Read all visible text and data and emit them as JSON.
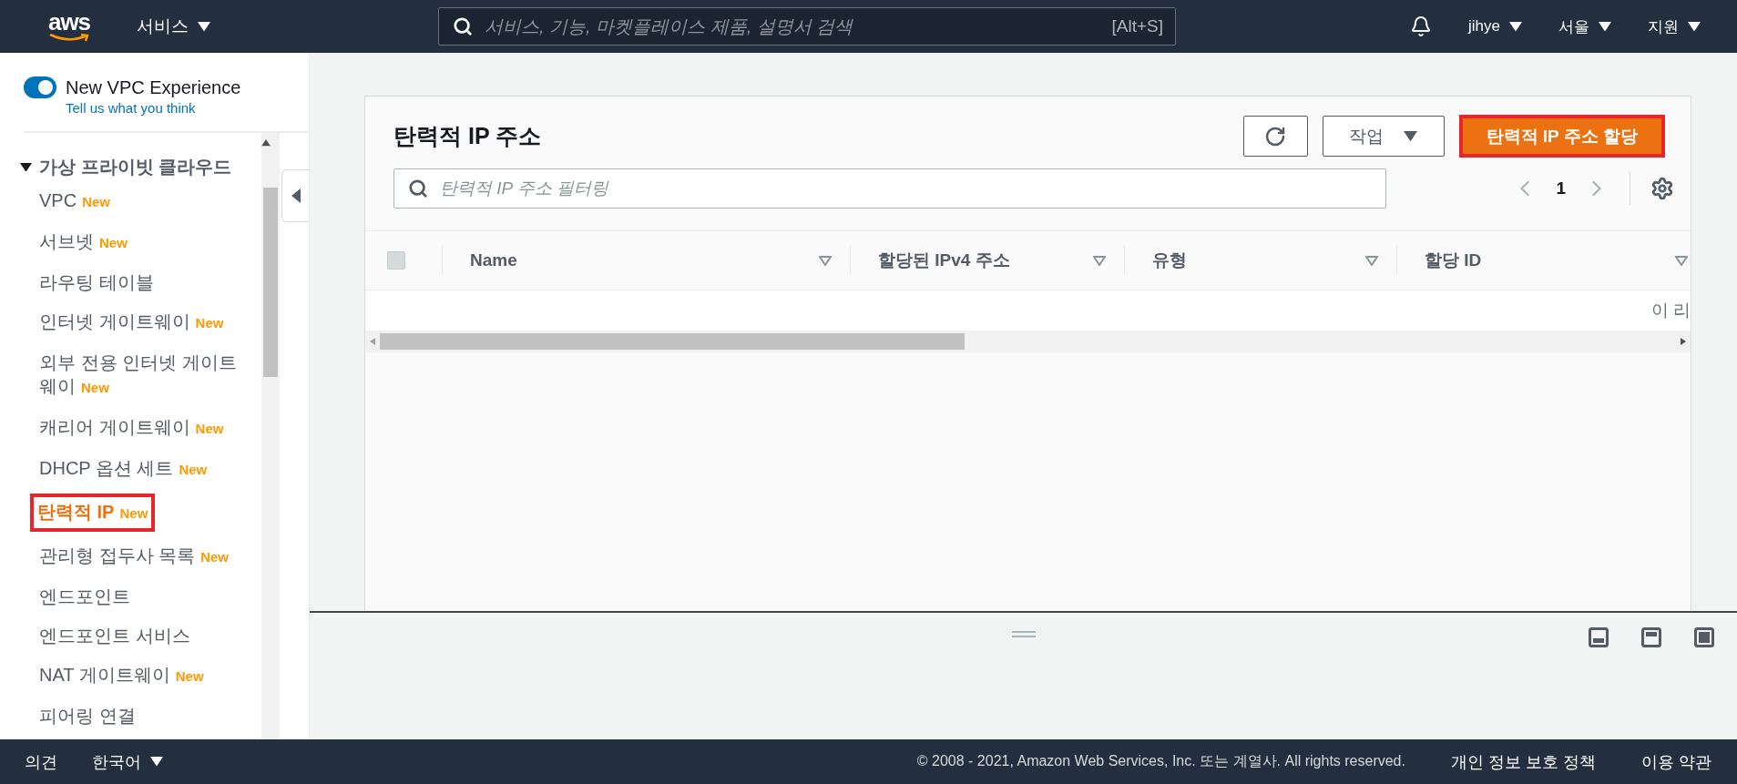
{
  "top_bar": {
    "logo": "aws",
    "services_menu": "서비스",
    "search": {
      "placeholder": "서비스, 기능, 마켓플레이스 제품, 설명서 검색",
      "shortcut": "[Alt+S]"
    },
    "user_menu": "jihye",
    "region_menu": "서울",
    "support_menu": "지원"
  },
  "sidebar": {
    "toggle": {
      "label": "New VPC Experience",
      "on": true
    },
    "feedback_link": "Tell us what you think",
    "section": {
      "title": "가상 프라이빗 클라우드",
      "expanded": true,
      "items": [
        {
          "label": "VPC",
          "badge": "New",
          "selected": false,
          "highlighted": false
        },
        {
          "label": "서브넷",
          "badge": "New",
          "selected": false,
          "highlighted": false
        },
        {
          "label": "라우팅 테이블",
          "selected": false,
          "highlighted": false
        },
        {
          "label": "인터넷 게이트웨이",
          "badge": "New",
          "selected": false,
          "highlighted": false
        },
        {
          "label": "외부 전용 인터넷 게이트웨이",
          "badge": "New",
          "selected": false,
          "highlighted": false
        },
        {
          "label": "캐리어 게이트웨이",
          "badge": "New",
          "selected": false,
          "highlighted": false
        },
        {
          "label": "DHCP 옵션 세트",
          "badge": "New",
          "selected": false,
          "highlighted": false
        },
        {
          "label": "탄력적 IP",
          "badge": "New",
          "selected": true,
          "highlighted": true
        },
        {
          "label": "관리형 접두사 목록",
          "badge": "New",
          "selected": false,
          "highlighted": false
        },
        {
          "label": "엔드포인트",
          "selected": false,
          "highlighted": false
        },
        {
          "label": "엔드포인트 서비스",
          "selected": false,
          "highlighted": false
        },
        {
          "label": "NAT 게이트웨이",
          "badge": "New",
          "selected": false,
          "highlighted": false
        },
        {
          "label": "피어링 연결",
          "selected": false,
          "highlighted": false
        }
      ]
    }
  },
  "panel": {
    "title": "탄력적 IP 주소",
    "actions_button": "작업",
    "primary_button": {
      "label": "탄력적 IP 주소 할당",
      "highlighted": true
    },
    "filter": {
      "placeholder": "탄력적 IP 주소 필터링"
    },
    "page": "1",
    "table": {
      "select_all": {
        "checked": false,
        "disabled": true
      },
      "columns": [
        "Name",
        "할당된 IPv4 주소",
        "유형",
        "할당 ID"
      ],
      "empty_message": "이 리"
    }
  },
  "footer": {
    "feedback": "의견",
    "language": "한국어",
    "copyright": "© 2008 - 2021, Amazon Web Services, Inc. 또는 계열사. All rights reserved.",
    "links": [
      "개인 정보 보호 정책",
      "이용 약관"
    ]
  }
}
